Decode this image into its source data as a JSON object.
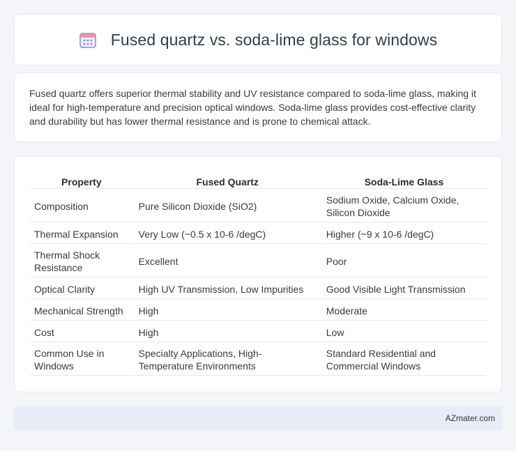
{
  "header": {
    "title": "Fused quartz vs. soda-lime glass for windows",
    "icon": "calendar-icon",
    "icon_color": "#6c7ff2"
  },
  "summary": {
    "text": "Fused quartz offers superior thermal stability and UV resistance compared to soda-lime glass, making it ideal for high-temperature and precision optical windows. Soda-lime glass provides cost-effective clarity and durability but has lower thermal resistance and is prone to chemical attack."
  },
  "table": {
    "headers": [
      "Property",
      "Fused Quartz",
      "Soda-Lime Glass"
    ],
    "rows": [
      [
        "Composition",
        "Pure Silicon Dioxide (SiO2)",
        "Sodium Oxide, Calcium Oxide, Silicon Dioxide"
      ],
      [
        "Thermal Expansion",
        "Very Low (~0.5 x 10-6 /degC)",
        "Higher (~9 x 10-6 /degC)"
      ],
      [
        "Thermal Shock Resistance",
        "Excellent",
        "Poor"
      ],
      [
        "Optical Clarity",
        "High UV Transmission, Low Impurities",
        "Good Visible Light Transmission"
      ],
      [
        "Mechanical Strength",
        "High",
        "Moderate"
      ],
      [
        "Cost",
        "High",
        "Low"
      ],
      [
        "Common Use in Windows",
        "Specialty Applications, High-Temperature Environments",
        "Standard Residential and Commercial Windows"
      ]
    ]
  },
  "footer": {
    "text": "AZmater.com"
  }
}
